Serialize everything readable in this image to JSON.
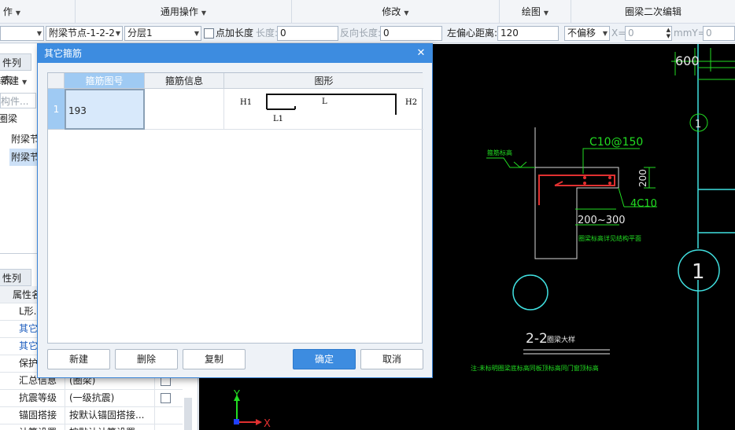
{
  "menubar": {
    "items": [
      "作",
      "通用操作",
      "修改",
      "绘图",
      "圈梁二次编辑"
    ]
  },
  "toolbar": {
    "floor_combo": "",
    "component_combo": "附梁节点-1-2-2",
    "layer_combo": "分层1",
    "add_length_label": "点加长度",
    "length_label": "长度:",
    "length_value": "0",
    "reverse_length_label": "反向长度:",
    "reverse_length_value": "0",
    "left_offset_label": "左偏心距离:",
    "left_offset_value": "120",
    "offset_combo": "不偏移",
    "x_label": "X=",
    "x_value": "0",
    "y_label": "mmY=",
    "y_value": "0"
  },
  "leftpanel": {
    "tab_component_list": "件列表",
    "new_button": "新建",
    "search_placeholder": "构件...",
    "tree": [
      "圈梁",
      "附梁节",
      "附梁节"
    ],
    "tab_property_list": "性列表",
    "property_header": "属性名",
    "properties": [
      {
        "name": "L形...",
        "value": "",
        "blue": false
      },
      {
        "name": "其它...",
        "value": "",
        "blue": true
      },
      {
        "name": "其它...",
        "value": "",
        "blue": true
      },
      {
        "name": "保护...",
        "value": "",
        "blue": false
      },
      {
        "name": "汇总信息",
        "value": "(圈梁)",
        "blue": false
      },
      {
        "name": "抗震等级",
        "value": "(一级抗震)",
        "blue": false
      },
      {
        "name": "锚固搭接",
        "value": "按默认锚固搭接...",
        "blue": false
      },
      {
        "name": "计算设置",
        "value": "按默认计算设置...",
        "blue": false
      }
    ]
  },
  "dialog": {
    "title": "其它箍筋",
    "columns": [
      "箍筋图号",
      "箍筋信息",
      "图形"
    ],
    "rows": [
      {
        "index": "1",
        "code": "193",
        "info": "",
        "shape_labels": {
          "h1": "H1",
          "l": "L",
          "h2": "H2",
          "l1": "L1"
        }
      }
    ],
    "buttons": {
      "new": "新建",
      "delete": "删除",
      "copy": "复制",
      "ok": "确定",
      "cancel": "取消"
    }
  },
  "canvas": {
    "dim_600": "600",
    "axis_label": "1",
    "axis_label_small": "1",
    "rebar_top": "C10@150",
    "dim_200": "200",
    "rebar_bottom": "4C10",
    "dim_range": "200~300",
    "note_left": "箍筋标高",
    "note_under": "圈梁标高详见结构平面",
    "section_title": "2-2",
    "section_suffix": "圈梁大样",
    "footnote": "注:未标明圈梁底标高同板顶标高同门窗顶标高",
    "axis_x": "X",
    "axis_y": "Y"
  },
  "colors": {
    "accent": "#3d8ce0",
    "selection": "#9fcaf3",
    "cad_background": "#000000",
    "cad_green": "#22dd22",
    "cad_cyan": "#40e0e0"
  }
}
